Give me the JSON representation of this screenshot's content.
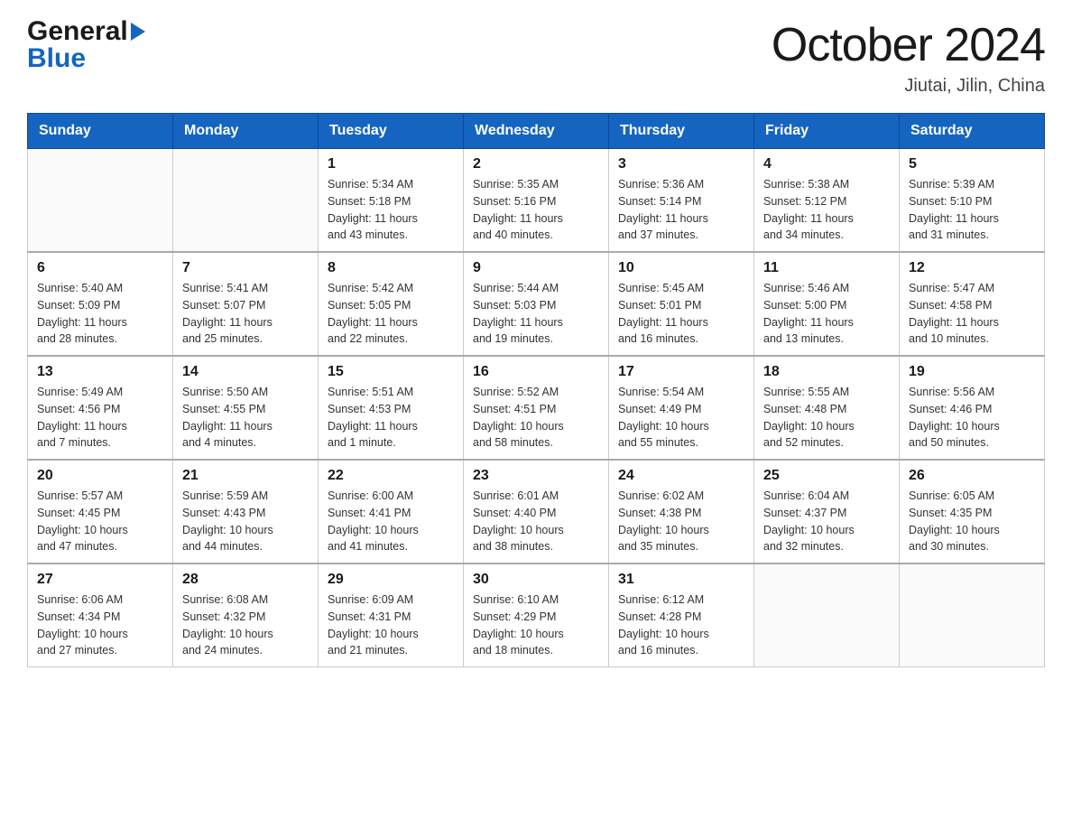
{
  "header": {
    "logo_general": "General",
    "logo_blue": "Blue",
    "title": "October 2024",
    "subtitle": "Jiutai, Jilin, China"
  },
  "calendar": {
    "days_of_week": [
      "Sunday",
      "Monday",
      "Tuesday",
      "Wednesday",
      "Thursday",
      "Friday",
      "Saturday"
    ],
    "weeks": [
      [
        {
          "day": "",
          "info": ""
        },
        {
          "day": "",
          "info": ""
        },
        {
          "day": "1",
          "info": "Sunrise: 5:34 AM\nSunset: 5:18 PM\nDaylight: 11 hours\nand 43 minutes."
        },
        {
          "day": "2",
          "info": "Sunrise: 5:35 AM\nSunset: 5:16 PM\nDaylight: 11 hours\nand 40 minutes."
        },
        {
          "day": "3",
          "info": "Sunrise: 5:36 AM\nSunset: 5:14 PM\nDaylight: 11 hours\nand 37 minutes."
        },
        {
          "day": "4",
          "info": "Sunrise: 5:38 AM\nSunset: 5:12 PM\nDaylight: 11 hours\nand 34 minutes."
        },
        {
          "day": "5",
          "info": "Sunrise: 5:39 AM\nSunset: 5:10 PM\nDaylight: 11 hours\nand 31 minutes."
        }
      ],
      [
        {
          "day": "6",
          "info": "Sunrise: 5:40 AM\nSunset: 5:09 PM\nDaylight: 11 hours\nand 28 minutes."
        },
        {
          "day": "7",
          "info": "Sunrise: 5:41 AM\nSunset: 5:07 PM\nDaylight: 11 hours\nand 25 minutes."
        },
        {
          "day": "8",
          "info": "Sunrise: 5:42 AM\nSunset: 5:05 PM\nDaylight: 11 hours\nand 22 minutes."
        },
        {
          "day": "9",
          "info": "Sunrise: 5:44 AM\nSunset: 5:03 PM\nDaylight: 11 hours\nand 19 minutes."
        },
        {
          "day": "10",
          "info": "Sunrise: 5:45 AM\nSunset: 5:01 PM\nDaylight: 11 hours\nand 16 minutes."
        },
        {
          "day": "11",
          "info": "Sunrise: 5:46 AM\nSunset: 5:00 PM\nDaylight: 11 hours\nand 13 minutes."
        },
        {
          "day": "12",
          "info": "Sunrise: 5:47 AM\nSunset: 4:58 PM\nDaylight: 11 hours\nand 10 minutes."
        }
      ],
      [
        {
          "day": "13",
          "info": "Sunrise: 5:49 AM\nSunset: 4:56 PM\nDaylight: 11 hours\nand 7 minutes."
        },
        {
          "day": "14",
          "info": "Sunrise: 5:50 AM\nSunset: 4:55 PM\nDaylight: 11 hours\nand 4 minutes."
        },
        {
          "day": "15",
          "info": "Sunrise: 5:51 AM\nSunset: 4:53 PM\nDaylight: 11 hours\nand 1 minute."
        },
        {
          "day": "16",
          "info": "Sunrise: 5:52 AM\nSunset: 4:51 PM\nDaylight: 10 hours\nand 58 minutes."
        },
        {
          "day": "17",
          "info": "Sunrise: 5:54 AM\nSunset: 4:49 PM\nDaylight: 10 hours\nand 55 minutes."
        },
        {
          "day": "18",
          "info": "Sunrise: 5:55 AM\nSunset: 4:48 PM\nDaylight: 10 hours\nand 52 minutes."
        },
        {
          "day": "19",
          "info": "Sunrise: 5:56 AM\nSunset: 4:46 PM\nDaylight: 10 hours\nand 50 minutes."
        }
      ],
      [
        {
          "day": "20",
          "info": "Sunrise: 5:57 AM\nSunset: 4:45 PM\nDaylight: 10 hours\nand 47 minutes."
        },
        {
          "day": "21",
          "info": "Sunrise: 5:59 AM\nSunset: 4:43 PM\nDaylight: 10 hours\nand 44 minutes."
        },
        {
          "day": "22",
          "info": "Sunrise: 6:00 AM\nSunset: 4:41 PM\nDaylight: 10 hours\nand 41 minutes."
        },
        {
          "day": "23",
          "info": "Sunrise: 6:01 AM\nSunset: 4:40 PM\nDaylight: 10 hours\nand 38 minutes."
        },
        {
          "day": "24",
          "info": "Sunrise: 6:02 AM\nSunset: 4:38 PM\nDaylight: 10 hours\nand 35 minutes."
        },
        {
          "day": "25",
          "info": "Sunrise: 6:04 AM\nSunset: 4:37 PM\nDaylight: 10 hours\nand 32 minutes."
        },
        {
          "day": "26",
          "info": "Sunrise: 6:05 AM\nSunset: 4:35 PM\nDaylight: 10 hours\nand 30 minutes."
        }
      ],
      [
        {
          "day": "27",
          "info": "Sunrise: 6:06 AM\nSunset: 4:34 PM\nDaylight: 10 hours\nand 27 minutes."
        },
        {
          "day": "28",
          "info": "Sunrise: 6:08 AM\nSunset: 4:32 PM\nDaylight: 10 hours\nand 24 minutes."
        },
        {
          "day": "29",
          "info": "Sunrise: 6:09 AM\nSunset: 4:31 PM\nDaylight: 10 hours\nand 21 minutes."
        },
        {
          "day": "30",
          "info": "Sunrise: 6:10 AM\nSunset: 4:29 PM\nDaylight: 10 hours\nand 18 minutes."
        },
        {
          "day": "31",
          "info": "Sunrise: 6:12 AM\nSunset: 4:28 PM\nDaylight: 10 hours\nand 16 minutes."
        },
        {
          "day": "",
          "info": ""
        },
        {
          "day": "",
          "info": ""
        }
      ]
    ]
  }
}
